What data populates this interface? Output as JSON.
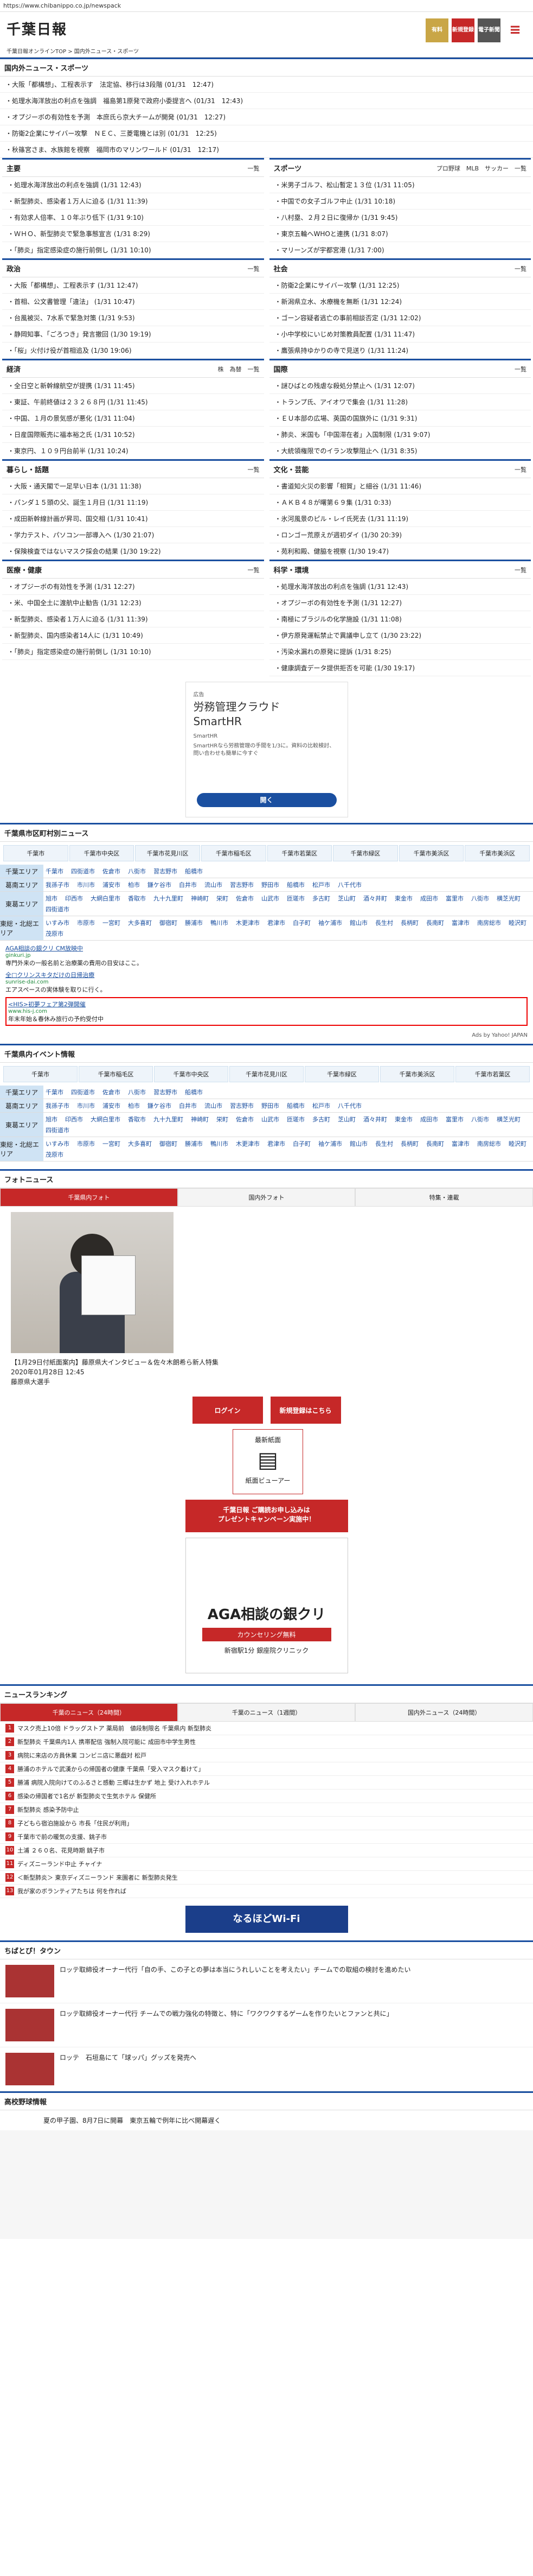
{
  "url": "https://www.chibanippo.co.jp/newspack",
  "site": {
    "logo": "千葉日報",
    "breadcrumb": "千葉日報オンラインTOP > 国内外ニュース・スポーツ"
  },
  "header_buttons": {
    "lock": "有料",
    "signup": "新規登録",
    "eshimen": "電子新聞",
    "menu": "≡"
  },
  "top_news": {
    "title": "国内外ニュース・スポーツ",
    "items": [
      "大阪「都構想」、工程表示す　法定協、移行は3段階 (01/31　12:47)",
      "処理水海洋放出の利点を強調　福島第1原発で政府小委提言へ (01/31　12:43)",
      "オプジーボの有効性を予測　本庶氏ら京大チームが開発 (01/31　12:27)",
      "防衛2企業にサイバー攻撃　ＮＥＣ、三菱電機とは別 (01/31　12:25)",
      "秋篠宮さま、水族館を視察　福岡市のマリンワールド (01/31　12:17)"
    ]
  },
  "sections": [
    {
      "title": "主要",
      "more": "一覧",
      "items": [
        "処理水海洋放出の利点を強調 (1/31 12:43)",
        "新型肺炎、感染者１万人に迫る (1/31 11:39)",
        "有効求人倍率、１０年ぶり低下 (1/31 9:10)",
        "ＷＨＯ、新型肺炎で緊急事態宣言 (1/31 8:29)",
        "「肺炎」指定感染症の施行前倒し (1/31 10:10)"
      ]
    },
    {
      "title": "スポーツ",
      "more": "プロ野球　MLB　サッカー　一覧",
      "items": [
        "米男子ゴルフ、松山暫定１３位 (1/31 11:05)",
        "中国での女子ゴルフ中止 (1/31 10:18)",
        "八村塁、２月２日に復帰か (1/31 9:45)",
        "東京五輪へWHOと連携 (1/31 8:07)",
        "マリーンズが宇都宮港 (1/31 7:00)"
      ]
    },
    {
      "title": "政治",
      "more": "一覧",
      "items": [
        "大阪「都構想」、工程表示す (1/31 12:47)",
        "首相、公文書管理「違法」 (1/31 10:47)",
        "台風被災、7水系で緊急対策 (1/31 9:53)",
        "静岡知事、「ごろつき」発言撤回 (1/30 19:19)",
        "「桜」火付け役が首相追及 (1/30 19:06)"
      ]
    },
    {
      "title": "社会",
      "more": "一覧",
      "items": [
        "防衛2企業にサイバー攻撃 (1/31 12:25)",
        "新潟県立水、水療機を無断 (1/31 12:24)",
        "ゴーン容疑者逃亡の事前相談否定 (1/31 12:02)",
        "小中学校にいじめ対策教員配置 (1/31 11:47)",
        "鷹張県持ゆかりの寺で見送り (1/31 11:24)"
      ]
    },
    {
      "title": "経済",
      "more": "株　為替　一覧",
      "items": [
        "全日空と新幹線航空が提携 (1/31 11:45)",
        "東証、午前終値は２３２６８円 (1/31 11:45)",
        "中国、１月の景気感が悪化 (1/31 11:04)",
        "日産国際販売に福本裕之氏 (1/31 10:52)",
        "東京円、１０９円台前半 (1/31 10:24)"
      ]
    },
    {
      "title": "国際",
      "more": "一覧",
      "items": [
        "謎ひばとの残虐な殺処分禁止へ (1/31 12:07)",
        "トランプ氏、アイオワで集会 (1/31 11:28)",
        "ＥＵ本部の広場、英国の国旗外に (1/31 9:31)",
        "肺炎、米国も「中国滞在者」入国制限 (1/31 9:07)",
        "大統領権限でのイラン攻撃阻止へ (1/31 8:35)"
      ]
    },
    {
      "title": "暮らし・話題",
      "more": "一覧",
      "items": [
        "大阪・通天閣で一足早い日本 (1/31 11:38)",
        "パンダ１５頭の父、誕生１月日 (1/31 11:19)",
        "成田新幹線計画が昇司、国交相 (1/31 10:41)",
        "学力テスト、パソコン一部導入へ (1/30 21:07)",
        "保険検査ではないマスク採会の結果 (1/30 19:22)"
      ]
    },
    {
      "title": "文化・芸能",
      "more": "一覧",
      "items": [
        "書道知火災の影響「相賀」と細谷 (1/31 11:46)",
        "ＡＫＢ４８が曙第６９集 (1/31 0:33)",
        "氷河風景のピル・レイ氏死去 (1/31 11:19)",
        "ロンゴー荒原えが週初ダイ (1/30 20:39)",
        "苑利和殿、健脇を視察 (1/30 19:47)"
      ]
    },
    {
      "title": "医療・健康",
      "more": "一覧",
      "items": [
        "オプジーボの有効性を予測 (1/31 12:27)",
        "米、中国全土に渡航中止勧告 (1/31 12:23)",
        "新型肺炎、感染者１万人に迫る (1/31 11:39)",
        "新型肺炎、国内感染者14人に (1/31 10:49)",
        "「肺炎」指定感染症の施行前倒し (1/31 10:10)"
      ]
    },
    {
      "title": "科学・環境",
      "more": "一覧",
      "items": [
        "処理水海洋放出の利点を強調 (1/31 12:43)",
        "オプジーボの有効性を予測 (1/31 12:27)",
        "南極にブラジルの化学施設 (1/31 11:08)",
        "伊方原発運転禁止で異議申し立て (1/30 23:22)",
        "汚染水漏れの原発に提訴 (1/31 8:25)",
        "健康調査データ提供拒否を可能 (1/30 19:17)"
      ]
    }
  ],
  "ad1": {
    "label": "広告",
    "title1": "労務管理クラウド",
    "title2": "SmartHR",
    "brand": "SmartHR",
    "desc": "SmartHRなら労務管理の手間を1/3に。資料の比較検討、問い合わせも簡単に今すぐ",
    "button": "開く"
  },
  "muni": {
    "title": "千葉県市区町村別ニュース",
    "tabs": [
      "千葉市",
      "千葉市中央区",
      "千葉市花見川区",
      "千葉市稲毛区",
      "千葉市若葉区",
      "千葉市緑区",
      "千葉市美浜区",
      "千葉市美浜区"
    ],
    "areas": [
      {
        "name": "千葉エリア",
        "cells": [
          "千葉市",
          "四街道市",
          "佐倉市",
          "八街市",
          "習志野市",
          "船橋市"
        ]
      },
      {
        "name": "葛南エリア",
        "cells": [
          "我孫子市",
          "市川市",
          "浦安市",
          "柏市",
          "鎌ケ谷市",
          "白井市",
          "流山市",
          "習志野市",
          "野田市",
          "船橋市",
          "松戸市",
          "八千代市"
        ]
      },
      {
        "name": "東葛エリア",
        "cells": [
          "旭市",
          "印西市",
          "大網白里市",
          "香取市",
          "九十九里町",
          "神崎町",
          "栄町",
          "佐倉市",
          "山武市",
          "匝瑳市",
          "多古町",
          "芝山町",
          "酒々井町",
          "東金市",
          "成田市",
          "富里市",
          "八街市",
          "横芝光町",
          "四街道市"
        ]
      },
      {
        "name": "東総・北総エリア",
        "cells": [
          "いすみ市",
          "市原市",
          "一宮町",
          "大多喜町",
          "御宿町",
          "勝浦市",
          "鴨川市",
          "木更津市",
          "君津市",
          "白子町",
          "袖ケ浦市",
          "館山市",
          "長生村",
          "長柄町",
          "長南町",
          "富津市",
          "南房総市",
          "睦沢町",
          "茂原市"
        ]
      }
    ]
  },
  "text_ads": [
    {
      "headline": "AGA相談の銀クリ CM放映中",
      "url": "ginkuri.jp",
      "desc": "専門外来の一般名前と治療薬の費用の目安はここ。"
    },
    {
      "headline": "全□クリンスキタだけの日帰治療",
      "url": "sunrise-dai.com",
      "desc": "エアスペースの実体験を取りに行く。"
    },
    {
      "headline": "<HIS>初夢フェア第2弾開催",
      "url": "www.his-j.com",
      "desc": "年末年始＆春休み旅行の予約受付中"
    }
  ],
  "ads_by": "Ads by Yahoo! JAPAN",
  "events": {
    "title": "千葉県内イベント情報",
    "tabs": [
      "千葉市",
      "千葉市稲毛区",
      "千葉市中央区",
      "千葉市花見川区",
      "千葉市緑区",
      "千葉市美浜区",
      "千葉市若葉区"
    ],
    "areas": [
      {
        "name": "千葉エリア",
        "cells": [
          "千葉市",
          "四街道市",
          "佐倉市",
          "八街市",
          "習志野市",
          "船橋市"
        ]
      },
      {
        "name": "葛南エリア",
        "cells": [
          "我孫子市",
          "市川市",
          "浦安市",
          "柏市",
          "鎌ケ谷市",
          "白井市",
          "流山市",
          "習志野市",
          "野田市",
          "船橋市",
          "松戸市",
          "八千代市"
        ]
      },
      {
        "name": "東葛エリア",
        "cells": [
          "旭市",
          "印西市",
          "大網白里市",
          "香取市",
          "九十九里町",
          "神崎町",
          "栄町",
          "佐倉市",
          "山武市",
          "匝瑳市",
          "多古町",
          "芝山町",
          "酒々井町",
          "東金市",
          "成田市",
          "富里市",
          "八街市",
          "横芝光町",
          "四街道市"
        ]
      },
      {
        "name": "東総・北総エリア",
        "cells": [
          "いすみ市",
          "市原市",
          "一宮町",
          "大多喜町",
          "御宿町",
          "勝浦市",
          "鴨川市",
          "木更津市",
          "君津市",
          "白子町",
          "袖ケ浦市",
          "館山市",
          "長生村",
          "長柄町",
          "長南町",
          "富津市",
          "南房総市",
          "睦沢町",
          "茂原市"
        ]
      }
    ]
  },
  "photo": {
    "title": "フォトニュース",
    "tabs": [
      "千葉県内フォト",
      "国内外フォト",
      "特集・連載"
    ],
    "caption": "【1月29日付紙面案内】藤原県大インタビュー＆佐々木朗希ら新人特集",
    "date": "2020年01月28日 12:45",
    "credit": "藤原県大選手"
  },
  "login": {
    "login": "ログイン",
    "signup": "新規登録はこちら"
  },
  "viewer": {
    "label": "最新紙面",
    "sub": "紙面ビューアー"
  },
  "banner": {
    "line1": "千葉日報 ご購読お申し込みは",
    "line2": "プレゼントキャンペーン実施中！"
  },
  "aga": {
    "title": "AGA相談の銀クリ",
    "sub": "カウンセリング無料",
    "note": "新宿駅1分 銀座院クリニック"
  },
  "ranking": {
    "title": "ニュースランキング",
    "tabs": [
      "千葉のニュース（24時間）",
      "千葉のニュース（1週間）",
      "国内外ニュース（24時間）"
    ],
    "items": [
      "マスク売上10倍 ドラッグストア 薬局前　値段制限名 千葉県内 新型肺炎",
      "新型肺炎 千葉県内1人 携帯配信 強制入院可能に 成田市中学生男性",
      "病院に来店の方員休業 コンビニ店に悪戯対 松戸",
      "勝浦のホテルで武漢からの帰国者の健康 千葉県「受入マスク着けて」",
      "勝浦 病院入院向けてのふるさと感動 三郷は生かず 地上 受け入れホテル",
      "感染の帰国者で1名が 新型肺炎で生気ホテル 保健所",
      "新型肺炎 感染予防中止",
      "子どもら宿泊施設から 市長「住民が利用」",
      "千葉市で前の暖気の支援、銚子市",
      "土浦 ２６０名、花見時期 銚子市",
      "ディズニーランド中止 チャイナ",
      "＜新型肺炎＞ 東京ディズニーランド 来園者に 新型肺炎発生",
      "我が家のボランティアたちは 何を作れば"
    ]
  },
  "wifi": "なるほどWi-Fi",
  "town": {
    "title": "ちばとぴ！タウン",
    "items": [
      "ロッテ取締役オーナー代行「自の手、この子との夢は本当にうれしいことを考えたい」チームでの取組の検討を進めたい",
      "ロッテ取締役オーナー代行 チームでの戦力強化の特徴と、特に「ワクワクするゲームを作りたいとファンと共に」",
      "ロッテ　石垣島にて「球ッパ」グッズを発売へ"
    ]
  },
  "hs": {
    "title": "高校野球情報",
    "items": [
      "夏の甲子園、8月7日に開幕　東京五輪で例年に比べ開幕遅く"
    ]
  }
}
